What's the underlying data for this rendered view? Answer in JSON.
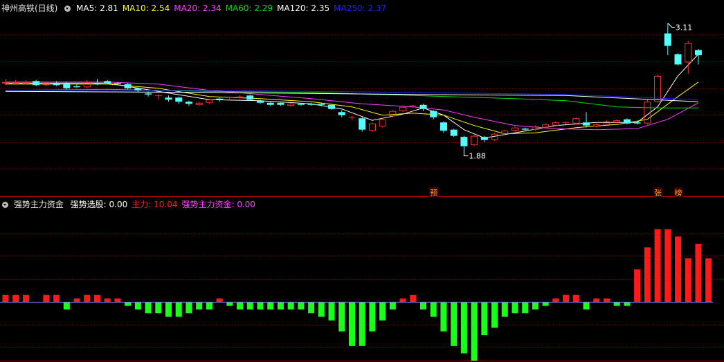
{
  "header": {
    "title": "神州高铁(日线)",
    "ma": [
      {
        "label": "MA5: ",
        "value": "2.81",
        "color": "#ffffff"
      },
      {
        "label": "MA10: ",
        "value": "2.54",
        "color": "#ffff00"
      },
      {
        "label": "MA20: ",
        "value": "2.34",
        "color": "#ff40ff"
      },
      {
        "label": "MA60: ",
        "value": "2.29",
        "color": "#00e000"
      },
      {
        "label": "MA120: ",
        "value": "2.35",
        "color": "#ffffff"
      },
      {
        "label": "MA250: ",
        "value": "2.37",
        "color": "#2020ff"
      }
    ]
  },
  "indicator": {
    "title": "强势主力资金",
    "fields": [
      {
        "label": "强势选股: ",
        "value": "0.00",
        "color": "#ffffff"
      },
      {
        "label": "主力: ",
        "value": "10.04",
        "color": "#ff2020"
      },
      {
        "label": "强势主力资金: ",
        "value": "0.00",
        "color": "#ff40ff"
      }
    ]
  },
  "markers": [
    {
      "text": "预",
      "index": 42
    },
    {
      "text": "张",
      "index": 64
    },
    {
      "text": "榜",
      "index": 66
    }
  ],
  "chart_data": {
    "type": "candlestick",
    "price_range": [
      1.45,
      3.2
    ],
    "high_label": "3.11",
    "low_label": "1.88",
    "candles": [
      [
        2.53,
        2.54,
        2.57,
        2.51
      ],
      [
        2.53,
        2.54,
        2.56,
        2.52
      ],
      [
        2.53,
        2.54,
        2.56,
        2.52
      ],
      [
        2.55,
        2.51,
        2.56,
        2.5
      ],
      [
        2.51,
        2.53,
        2.55,
        2.5
      ],
      [
        2.53,
        2.51,
        2.55,
        2.5
      ],
      [
        2.53,
        2.48,
        2.54,
        2.47
      ],
      [
        2.5,
        2.49,
        2.52,
        2.48
      ],
      [
        2.49,
        2.54,
        2.56,
        2.48
      ],
      [
        2.53,
        2.52,
        2.57,
        2.51
      ],
      [
        2.55,
        2.53,
        2.56,
        2.52
      ],
      [
        2.53,
        2.52,
        2.54,
        2.51
      ],
      [
        2.52,
        2.48,
        2.53,
        2.47
      ],
      [
        2.48,
        2.46,
        2.49,
        2.44
      ],
      [
        2.43,
        2.42,
        2.45,
        2.4
      ],
      [
        2.41,
        2.41,
        2.42,
        2.37
      ],
      [
        2.39,
        2.37,
        2.41,
        2.35
      ],
      [
        2.39,
        2.35,
        2.4,
        2.33
      ],
      [
        2.35,
        2.33,
        2.36,
        2.31
      ],
      [
        2.32,
        2.34,
        2.35,
        2.31
      ],
      [
        2.34,
        2.37,
        2.38,
        2.33
      ],
      [
        2.38,
        2.37,
        2.39,
        2.35
      ],
      [
        2.39,
        2.39,
        2.4,
        2.36
      ],
      [
        2.39,
        2.4,
        2.41,
        2.38
      ],
      [
        2.41,
        2.37,
        2.42,
        2.36
      ],
      [
        2.36,
        2.34,
        2.37,
        2.33
      ],
      [
        2.34,
        2.32,
        2.35,
        2.31
      ],
      [
        2.34,
        2.32,
        2.35,
        2.31
      ],
      [
        2.31,
        2.33,
        2.34,
        2.3
      ],
      [
        2.33,
        2.32,
        2.34,
        2.31
      ],
      [
        2.33,
        2.32,
        2.34,
        2.31
      ],
      [
        2.33,
        2.32,
        2.34,
        2.31
      ],
      [
        2.32,
        2.28,
        2.33,
        2.27
      ],
      [
        2.25,
        2.22,
        2.27,
        2.2
      ],
      [
        2.2,
        2.2,
        2.21,
        2.18
      ],
      [
        2.19,
        2.08,
        2.2,
        2.06
      ],
      [
        2.07,
        2.14,
        2.15,
        2.06
      ],
      [
        2.11,
        2.18,
        2.19,
        2.1
      ],
      [
        2.21,
        2.26,
        2.27,
        2.2
      ],
      [
        2.26,
        2.3,
        2.31,
        2.25
      ],
      [
        2.31,
        2.31,
        2.32,
        2.29
      ],
      [
        2.32,
        2.28,
        2.33,
        2.26
      ],
      [
        2.26,
        2.2,
        2.27,
        2.18
      ],
      [
        2.15,
        2.07,
        2.16,
        2.05
      ],
      [
        2.08,
        2.02,
        2.09,
        2.01
      ],
      [
        2.01,
        1.92,
        2.02,
        1.88
      ],
      [
        1.93,
        2.02,
        2.03,
        1.92
      ],
      [
        2.01,
        1.98,
        2.02,
        1.96
      ],
      [
        1.98,
        2.04,
        2.05,
        1.97
      ],
      [
        2.04,
        2.07,
        2.08,
        2.03
      ],
      [
        2.07,
        2.1,
        2.11,
        2.06
      ],
      [
        2.09,
        2.08,
        2.1,
        2.07
      ],
      [
        2.08,
        2.11,
        2.12,
        2.07
      ],
      [
        2.1,
        2.13,
        2.14,
        2.09
      ],
      [
        2.12,
        2.15,
        2.16,
        2.11
      ],
      [
        2.15,
        2.15,
        2.16,
        2.13
      ],
      [
        2.14,
        2.19,
        2.2,
        2.13
      ],
      [
        2.15,
        2.12,
        2.25,
        2.1
      ],
      [
        2.11,
        2.13,
        2.14,
        2.1
      ],
      [
        2.13,
        2.16,
        2.17,
        2.12
      ],
      [
        2.15,
        2.17,
        2.18,
        2.14
      ],
      [
        2.18,
        2.14,
        2.19,
        2.13
      ],
      [
        2.15,
        2.14,
        2.16,
        2.13
      ],
      [
        2.14,
        2.35,
        2.37,
        2.13
      ],
      [
        2.35,
        2.6,
        2.61,
        2.34
      ],
      [
        3.01,
        2.89,
        3.11,
        2.8
      ],
      [
        2.81,
        2.71,
        2.82,
        2.7
      ],
      [
        2.73,
        2.92,
        2.94,
        2.62
      ],
      [
        2.85,
        2.8,
        2.86,
        2.71
      ]
    ],
    "ma_lines": [
      {
        "name": "MA5",
        "color": "#ffffff",
        "points": [
          [
            0,
            2.53
          ],
          [
            10,
            2.53
          ],
          [
            15,
            2.45
          ],
          [
            20,
            2.37
          ],
          [
            25,
            2.36
          ],
          [
            30,
            2.33
          ],
          [
            33,
            2.28
          ],
          [
            36,
            2.17
          ],
          [
            39,
            2.23
          ],
          [
            41,
            2.29
          ],
          [
            43,
            2.22
          ],
          [
            45,
            2.08
          ],
          [
            47,
            2.0
          ],
          [
            50,
            2.05
          ],
          [
            54,
            2.12
          ],
          [
            58,
            2.15
          ],
          [
            62,
            2.15
          ],
          [
            64,
            2.3
          ],
          [
            66,
            2.6
          ],
          [
            68,
            2.81
          ]
        ]
      },
      {
        "name": "MA10",
        "color": "#ffff00",
        "points": [
          [
            0,
            2.52
          ],
          [
            10,
            2.52
          ],
          [
            15,
            2.48
          ],
          [
            20,
            2.4
          ],
          [
            25,
            2.38
          ],
          [
            30,
            2.35
          ],
          [
            34,
            2.3
          ],
          [
            37,
            2.22
          ],
          [
            40,
            2.24
          ],
          [
            43,
            2.22
          ],
          [
            46,
            2.12
          ],
          [
            49,
            2.04
          ],
          [
            52,
            2.05
          ],
          [
            56,
            2.1
          ],
          [
            60,
            2.13
          ],
          [
            63,
            2.18
          ],
          [
            66,
            2.4
          ],
          [
            68,
            2.54
          ]
        ]
      },
      {
        "name": "MA20",
        "color": "#ff40ff",
        "points": [
          [
            0,
            2.54
          ],
          [
            10,
            2.54
          ],
          [
            15,
            2.52
          ],
          [
            20,
            2.46
          ],
          [
            25,
            2.42
          ],
          [
            30,
            2.38
          ],
          [
            35,
            2.33
          ],
          [
            40,
            2.3
          ],
          [
            43,
            2.27
          ],
          [
            46,
            2.2
          ],
          [
            50,
            2.12
          ],
          [
            54,
            2.09
          ],
          [
            58,
            2.08
          ],
          [
            62,
            2.09
          ],
          [
            65,
            2.18
          ],
          [
            68,
            2.34
          ]
        ]
      },
      {
        "name": "MA60",
        "color": "#00e000",
        "points": [
          [
            0,
            2.46
          ],
          [
            10,
            2.47
          ],
          [
            20,
            2.45
          ],
          [
            30,
            2.44
          ],
          [
            40,
            2.41
          ],
          [
            50,
            2.38
          ],
          [
            55,
            2.36
          ],
          [
            60,
            2.3
          ],
          [
            64,
            2.29
          ],
          [
            68,
            2.29
          ]
        ]
      },
      {
        "name": "MA120",
        "color": "#ffffff",
        "points": [
          [
            0,
            2.45
          ],
          [
            20,
            2.44
          ],
          [
            40,
            2.42
          ],
          [
            55,
            2.41
          ],
          [
            68,
            2.35
          ]
        ]
      },
      {
        "name": "MA250",
        "color": "#2020ff",
        "points": [
          [
            0,
            2.46
          ],
          [
            20,
            2.46
          ],
          [
            40,
            2.44
          ],
          [
            55,
            2.42
          ],
          [
            68,
            2.37
          ]
        ]
      }
    ],
    "volume_range": [
      -16,
      26
    ],
    "indicator_bars": [
      2,
      2,
      2,
      0,
      2,
      2,
      -2,
      1,
      2,
      2,
      1,
      1,
      -1,
      -2,
      -3,
      -3,
      -4,
      -4,
      -3,
      -2,
      -2,
      1,
      -1,
      -2,
      -2,
      -2,
      -2,
      -2,
      -2,
      -2,
      -3,
      -4,
      -5,
      -8,
      -12,
      -12,
      -8,
      -5,
      -2,
      1,
      2,
      -2,
      -4,
      -8,
      -12,
      -14,
      -16,
      -9,
      -7,
      -4,
      -3,
      -3,
      -2,
      -1,
      1,
      2,
      2,
      -2,
      1,
      1,
      -1,
      -1,
      9,
      15,
      20,
      20,
      18,
      12,
      16,
      12
    ]
  }
}
